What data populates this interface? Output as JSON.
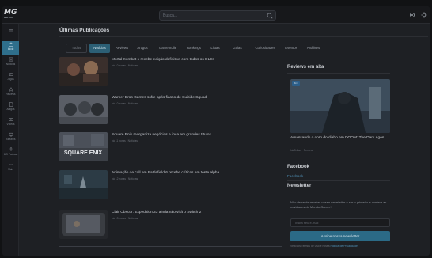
{
  "header": {
    "logo_text": "MG",
    "logo_sub": "GAME",
    "search_placeholder": "Busca..."
  },
  "sidebar": {
    "items": [
      {
        "label": "",
        "icon": "menu-icon"
      },
      {
        "label": "Início",
        "icon": "home-icon"
      },
      {
        "label": "Notícias",
        "icon": "news-icon"
      },
      {
        "label": "Jogos",
        "icon": "gamepad-icon"
      },
      {
        "label": "Reviews",
        "icon": "star-icon"
      },
      {
        "label": "Artigos",
        "icon": "article-icon"
      },
      {
        "label": "Vídeos",
        "icon": "video-icon"
      },
      {
        "label": "Streams",
        "icon": "stream-icon"
      },
      {
        "label": "MG Podcast",
        "icon": "mic-icon"
      },
      {
        "label": "Mais",
        "icon": "dots-icon"
      }
    ]
  },
  "main": {
    "section_title": "Últimas Publicações",
    "tabs": [
      "Todos",
      "Notícias",
      "Reviews",
      "Artigos",
      "Game Indie",
      "Rankings",
      "Listas",
      "Guias",
      "Curiosidades",
      "Eventos",
      "Análises"
    ],
    "articles": [
      {
        "title": "Mortal Kombat 1 recebe edição definitiva com todos os DLCs",
        "meta": "há 10 horas · Notícias"
      },
      {
        "title": "Warner Bros Games sofre após fiasco de Suicide Squad",
        "meta": "há 10 horas · Notícias"
      },
      {
        "title": "Square Enix reorganiza negócios e foca em grandes títulos",
        "meta": "há 11 horas · Notícias"
      },
      {
        "title": "Animação de call em Battlefield 6 recebe críticas em teste alpha",
        "meta": "há 12 horas · Notícias"
      },
      {
        "title": "Clair Obscur: Expedition 33 ainda não virá o Switch 2",
        "meta": "há 13 horas · Notícias"
      }
    ]
  },
  "right": {
    "reviews_heading": "Reviews em alta",
    "featured": {
      "badge": "8.5",
      "title": "Amassando o coro do diabo em DOOM: The Dark Ages",
      "meta": "há 3 dias · Review"
    },
    "facebook_heading": "Facebook",
    "facebook_link": "Facebook",
    "newsletter_heading": "Newsletter",
    "newsletter_text": "Não deixe de receber nossa newsletter e ser o primeiro a conferir as novidades do Mundo Gamer!",
    "email_placeholder": "Insira seu e-mail",
    "subscribe_label": "Assine nossa newsletter",
    "footer_prefix": "Veja nos Termos de Uso e nossa ",
    "footer_link": "Política de Privacidade"
  },
  "colors": {
    "accent": "#2f6f8c",
    "background": "#1e2024",
    "link": "#4f8fb4"
  }
}
